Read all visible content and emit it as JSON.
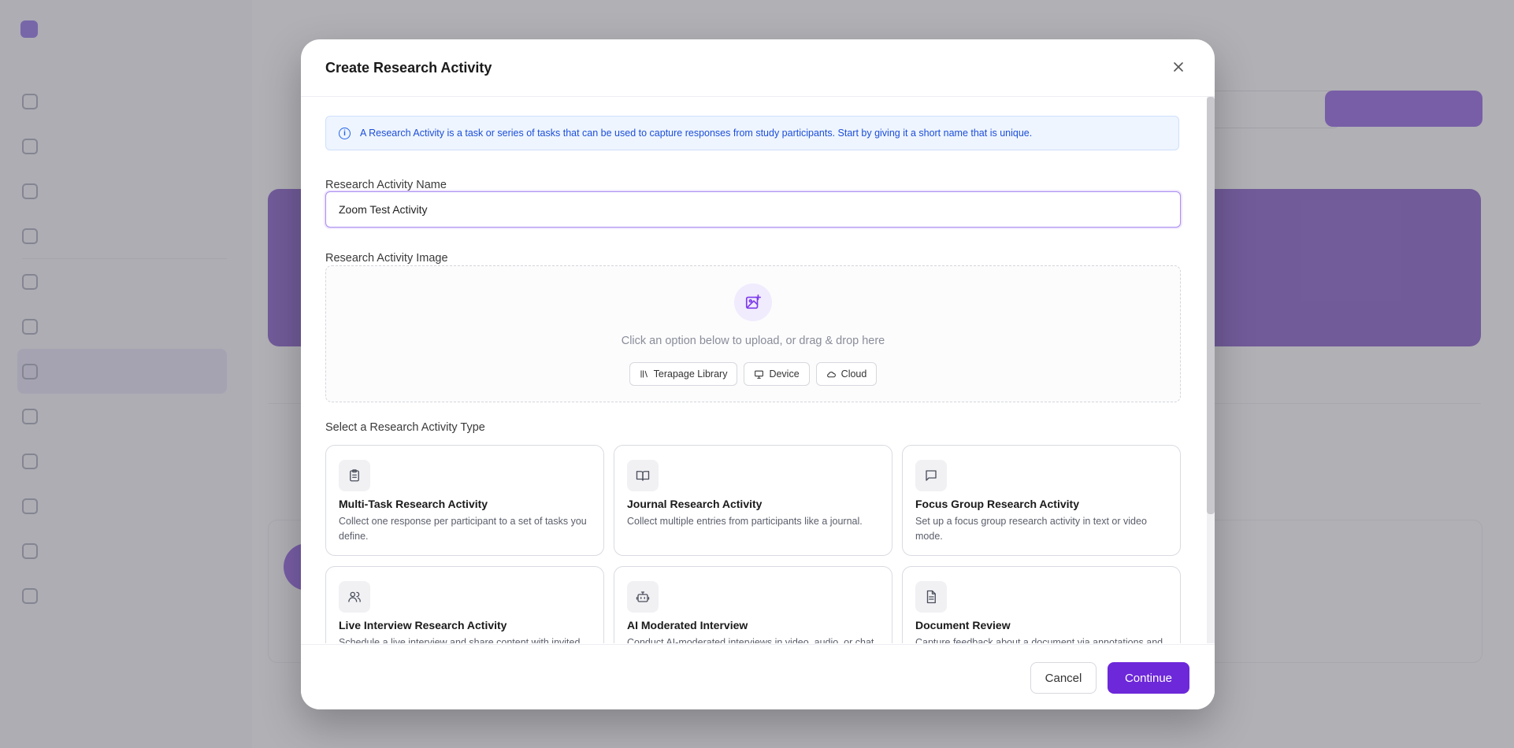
{
  "modal": {
    "title": "Create Research Activity",
    "info_text": "A Research Activity is a task or series of tasks that can be used to capture responses from study participants. Start by giving it a short name that is unique.",
    "name_label": "Research Activity Name",
    "name_value": "Zoom Test Activity",
    "image_label": "Research Activity Image",
    "drop_text": "Click an option below to upload, or drag & drop here",
    "sources": [
      {
        "label": "Terapage Library",
        "icon": "library-icon"
      },
      {
        "label": "Device",
        "icon": "monitor-icon"
      },
      {
        "label": "Cloud",
        "icon": "cloud-icon"
      }
    ],
    "type_label": "Select a Research Activity Type",
    "types": [
      {
        "title": "Multi-Task Research Activity",
        "desc": "Collect one response per participant to a set of tasks you define.",
        "icon": "clipboard-icon"
      },
      {
        "title": "Journal Research Activity",
        "desc": "Collect multiple entries from participants like a journal.",
        "icon": "book-icon"
      },
      {
        "title": "Focus Group Research Activity",
        "desc": "Set up a focus group research activity in text or video mode.",
        "icon": "message-icon"
      },
      {
        "title": "Live Interview Research Activity",
        "desc": "Schedule a live interview and share content with invited",
        "icon": "users-icon"
      },
      {
        "title": "AI Moderated Interview",
        "desc": "Conduct AI-moderated interviews in video, audio, or chat",
        "icon": "bot-icon"
      },
      {
        "title": "Document Review",
        "desc": "Capture feedback about a document via annotations and",
        "icon": "document-icon"
      }
    ],
    "cancel_label": "Cancel",
    "continue_label": "Continue"
  },
  "colors": {
    "accent": "#6d28d9",
    "info_bg": "#eef5ff",
    "info_text": "#1d4ed8"
  }
}
